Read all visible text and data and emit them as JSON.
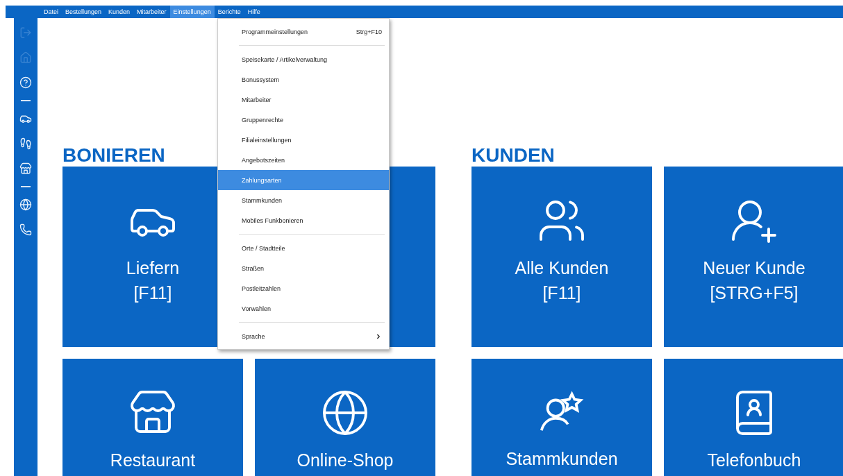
{
  "menubar": [
    {
      "label": "Datei",
      "selected": false
    },
    {
      "label": "Bestellungen",
      "selected": false
    },
    {
      "label": "Kunden",
      "selected": false
    },
    {
      "label": "Mitarbeiter",
      "selected": false
    },
    {
      "label": "Einstellungen",
      "selected": true
    },
    {
      "label": "Berichte",
      "selected": false
    },
    {
      "label": "Hilfe",
      "selected": false
    }
  ],
  "sidebar": {
    "items": [
      {
        "kind": "button",
        "disabled": true
      },
      {
        "kind": "button",
        "disabled": true
      },
      {
        "kind": "button",
        "disabled": false
      },
      {
        "kind": "separator"
      },
      {
        "kind": "button",
        "disabled": false
      },
      {
        "kind": "button",
        "disabled": false
      },
      {
        "kind": "button",
        "disabled": false
      },
      {
        "kind": "separator"
      },
      {
        "kind": "button",
        "disabled": false
      },
      {
        "kind": "button",
        "disabled": false
      }
    ]
  },
  "sections": [
    {
      "title": "BONIEREN",
      "tiles": [
        {
          "kind": "tile",
          "label": "Liefern",
          "shortcut": "[F11]"
        },
        {
          "kind": "blank"
        },
        {
          "kind": "tile",
          "label": "Restaurant"
        },
        {
          "kind": "tile",
          "label": "Online-Shop"
        }
      ]
    },
    {
      "title": "KUNDEN",
      "tiles": [
        {
          "kind": "tile",
          "label": "Alle Kunden",
          "shortcut": "[F11]"
        },
        {
          "kind": "tile",
          "label": "Neuer Kunde",
          "shortcut": "[STRG+F5]"
        },
        {
          "kind": "tile",
          "label": "Stammkunden"
        },
        {
          "kind": "tile",
          "label": "Telefonbuch"
        }
      ]
    }
  ],
  "dropdown": {
    "items": [
      {
        "kind": "item",
        "label": "Programmeinstellungen",
        "shortcut": "Strg+F10",
        "selected": false
      },
      {
        "kind": "separator"
      },
      {
        "kind": "item",
        "label": "Speisekarte / Artikelverwaltung",
        "selected": false
      },
      {
        "kind": "item",
        "label": "Bonussystem",
        "selected": false
      },
      {
        "kind": "item",
        "label": "Mitarbeiter",
        "selected": false
      },
      {
        "kind": "item",
        "label": "Gruppenrechte",
        "selected": false
      },
      {
        "kind": "item",
        "label": "Filialeinstellungen",
        "selected": false
      },
      {
        "kind": "item",
        "label": "Angebotszeiten",
        "selected": false
      },
      {
        "kind": "item",
        "label": "Zahlungsarten",
        "selected": true
      },
      {
        "kind": "item",
        "label": "Stammkunden",
        "selected": false
      },
      {
        "kind": "item",
        "label": "Mobiles Funkbonieren",
        "selected": false
      },
      {
        "kind": "separator"
      },
      {
        "kind": "item",
        "label": "Orte / Stadtteile",
        "selected": false
      },
      {
        "kind": "item",
        "label": "Straßen",
        "selected": false
      },
      {
        "kind": "item",
        "label": "Postleitzahlen",
        "selected": false
      },
      {
        "kind": "item",
        "label": "Vorwahlen",
        "selected": false
      },
      {
        "kind": "separator"
      },
      {
        "kind": "submenu",
        "label": "Sprache",
        "selected": false
      }
    ]
  }
}
